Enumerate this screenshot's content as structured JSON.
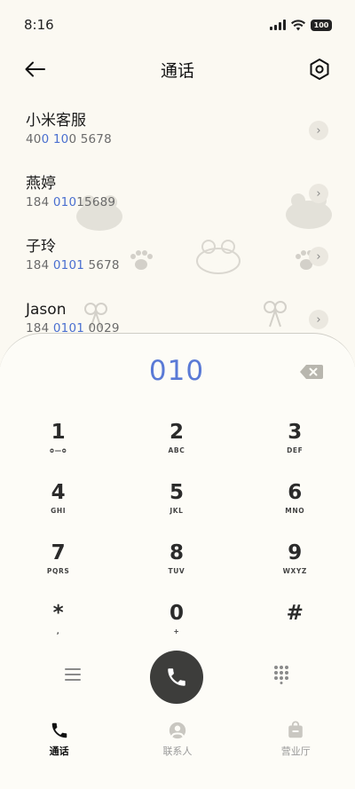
{
  "status_bar": {
    "time": "8:16",
    "battery": "100"
  },
  "header": {
    "title": "通话"
  },
  "calls": [
    {
      "name": "小米客服",
      "number_parts": [
        "40",
        "0 10",
        "0 5678"
      ]
    },
    {
      "name": "燕婷",
      "number_parts": [
        "184 ",
        "010",
        "15689"
      ]
    },
    {
      "name": "子玲",
      "number_parts": [
        "184 ",
        "0101",
        " 5678"
      ]
    },
    {
      "name": "Jason",
      "number_parts": [
        "184 ",
        "0101",
        " 0029"
      ]
    }
  ],
  "dialer": {
    "input": "010",
    "keys": [
      {
        "digit": "1",
        "letters": "ᴑ—ᴑ"
      },
      {
        "digit": "2",
        "letters": "ABC"
      },
      {
        "digit": "3",
        "letters": "DEF"
      },
      {
        "digit": "4",
        "letters": "GHI"
      },
      {
        "digit": "5",
        "letters": "JKL"
      },
      {
        "digit": "6",
        "letters": "MNO"
      },
      {
        "digit": "7",
        "letters": "PQRS"
      },
      {
        "digit": "8",
        "letters": "TUV"
      },
      {
        "digit": "9",
        "letters": "WXYZ"
      },
      {
        "digit": "*",
        "letters": ","
      },
      {
        "digit": "0",
        "letters": "+"
      },
      {
        "digit": "#",
        "letters": ""
      }
    ]
  },
  "bottom_nav": {
    "tabs": [
      {
        "label": "通话",
        "icon": "phone-icon",
        "active": true
      },
      {
        "label": "联系人",
        "icon": "contact-icon",
        "active": false
      },
      {
        "label": "营业厅",
        "icon": "store-icon",
        "active": false
      }
    ]
  },
  "colors": {
    "accent": "#5a7ad6",
    "background": "#fbf9f2",
    "call_button": "#3d3d3b"
  }
}
